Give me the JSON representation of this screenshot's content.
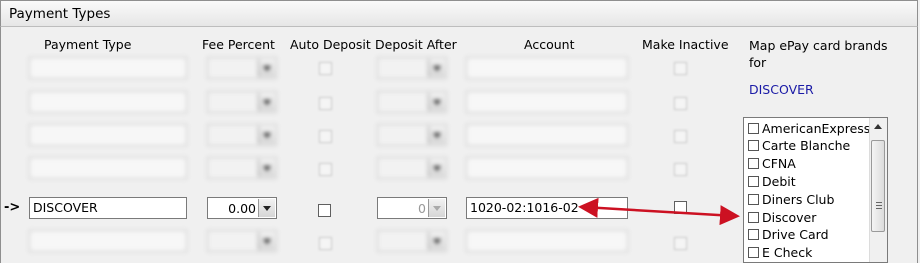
{
  "window": {
    "title": "Payment Types"
  },
  "headers": {
    "payment_type": "Payment Type",
    "fee_percent": "Fee Percent",
    "auto_deposit": "Auto Deposit",
    "deposit_after": "Deposit After",
    "account": "Account",
    "make_inactive": "Make Inactive"
  },
  "rows": [
    {
      "payment_type": "DISCOVER",
      "fee_percent": "0.00",
      "deposit_after": "0",
      "account": "1020-02:1016-02"
    }
  ],
  "row_marker": "->",
  "map": {
    "label": "Map ePay card brands for",
    "selected_type": "DISCOVER",
    "brands": [
      "AmericanExpress",
      "Carte Blanche",
      "CFNA",
      "Debit",
      "Diners Club",
      "Discover",
      "Drive Card",
      "E Check"
    ]
  },
  "annotation_color": "#cc1122"
}
